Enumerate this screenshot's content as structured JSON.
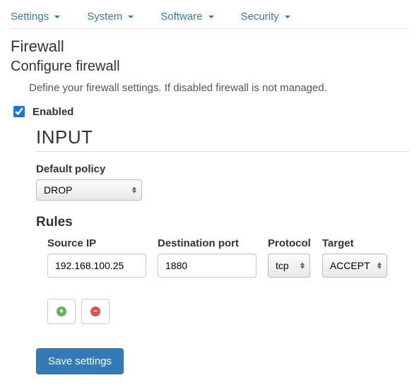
{
  "nav": {
    "items": [
      {
        "label": "Settings"
      },
      {
        "label": "System"
      },
      {
        "label": "Software"
      },
      {
        "label": "Security"
      }
    ]
  },
  "page": {
    "title": "Firewall",
    "subtitle": "Configure firewall",
    "description": "Define your firewall settings. If disabled firewall is not managed."
  },
  "enabled": {
    "label": "Enabled",
    "checked": true
  },
  "chain": {
    "title": "INPUT",
    "default_policy_label": "Default policy",
    "default_policy_value": "DROP",
    "rules_label": "Rules",
    "columns": {
      "source_ip": "Source IP",
      "dest_port": "Destination port",
      "protocol": "Protocol",
      "target": "Target"
    },
    "rules": [
      {
        "source_ip": "192.168.100.25",
        "dest_port": "1880",
        "protocol": "tcp",
        "target": "ACCEPT"
      }
    ]
  },
  "actions": {
    "save": "Save settings"
  }
}
